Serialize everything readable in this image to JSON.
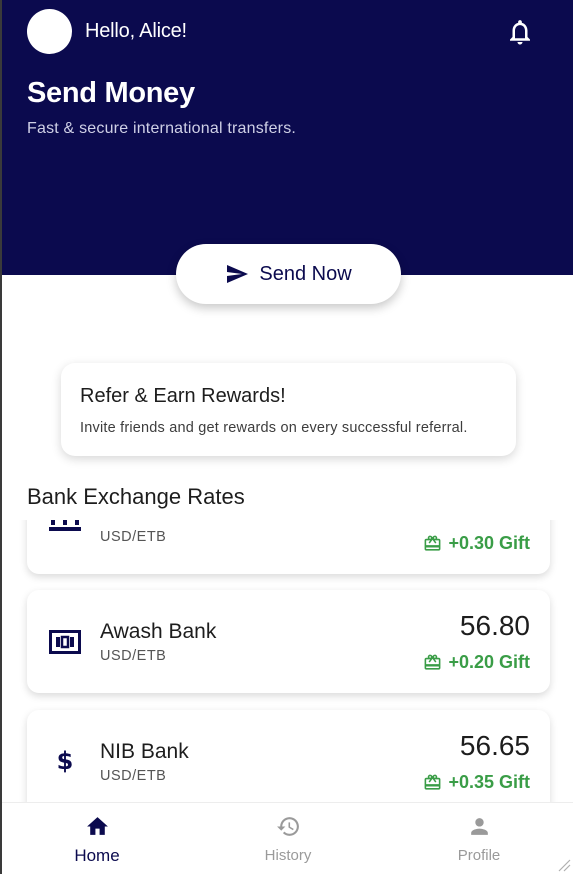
{
  "header": {
    "greeting": "Hello, Alice!",
    "title": "Send Money",
    "subtitle": "Fast & secure international transfers.",
    "send_button_label": "Send Now"
  },
  "referral": {
    "title": "Refer & Earn Rewards!",
    "text": "Invite friends and get rewards on every successful referral."
  },
  "rates": {
    "title": "Bank Exchange Rates",
    "banks": [
      {
        "name": "",
        "pair": "USD/ETB",
        "rate": "",
        "gift": "+0.30 Gift",
        "icon": "bank-building-icon"
      },
      {
        "name": "Awash Bank",
        "pair": "USD/ETB",
        "rate": "56.80",
        "gift": "+0.20 Gift",
        "icon": "money-bill-icon"
      },
      {
        "name": "NIB Bank",
        "pair": "USD/ETB",
        "rate": "56.65",
        "gift": "+0.35 Gift",
        "icon": "dollar-sign-icon"
      }
    ]
  },
  "nav": {
    "items": [
      {
        "label": "Home",
        "icon": "home-icon",
        "active": true
      },
      {
        "label": "History",
        "icon": "history-icon",
        "active": false
      },
      {
        "label": "Profile",
        "icon": "person-icon",
        "active": false
      }
    ]
  },
  "colors": {
    "primary": "#0b0a4e",
    "gift_green": "#3a9d47",
    "inactive_nav": "#9a9a9a"
  }
}
